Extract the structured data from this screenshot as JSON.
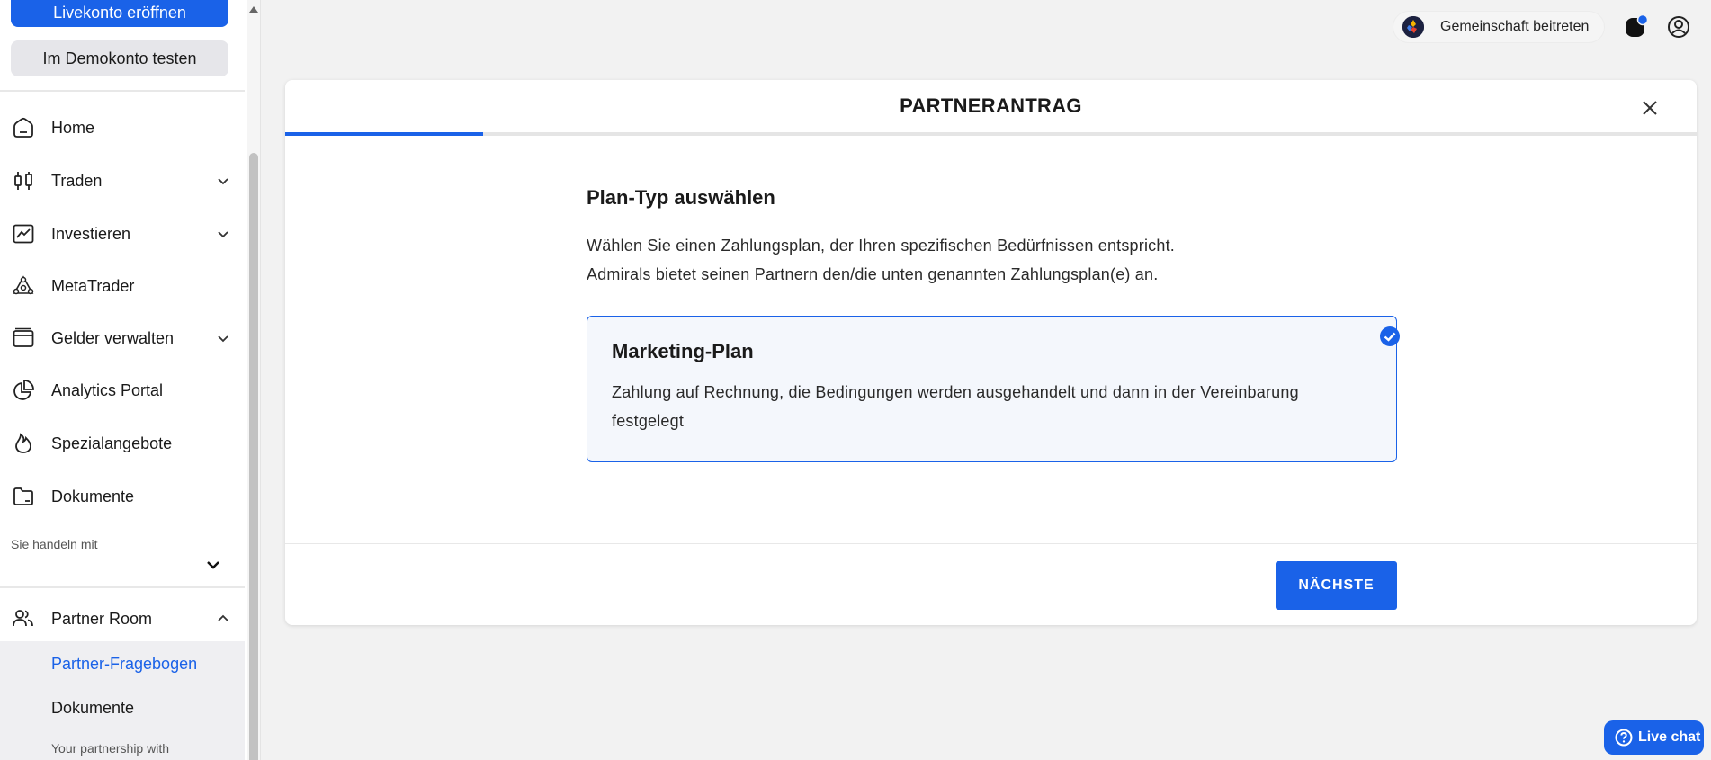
{
  "sidebar": {
    "live_account_button": "Livekonto eröffnen",
    "demo_account_button": "Im Demokonto testen",
    "nav_items": [
      {
        "label": "Home",
        "icon": "home-icon"
      },
      {
        "label": "Traden",
        "icon": "candlestick-icon"
      },
      {
        "label": "Investieren",
        "icon": "chart-line-icon"
      },
      {
        "label": "MetaTrader",
        "icon": "metatrader-icon"
      },
      {
        "label": "Gelder verwalten",
        "icon": "wallet-icon"
      },
      {
        "label": "Analytics Portal",
        "icon": "pie-chart-icon"
      },
      {
        "label": "Spezialangebote",
        "icon": "flame-icon"
      },
      {
        "label": "Dokumente",
        "icon": "folder-icon"
      }
    ],
    "trading_with_label": "Sie handeln mit",
    "partner_room": {
      "label": "Partner Room",
      "icon": "people-icon",
      "sub_items": [
        {
          "label": "Partner-Fragebogen",
          "active": true
        },
        {
          "label": "Dokumente",
          "active": false
        }
      ],
      "partnership_text": "Your partnership with"
    }
  },
  "topbar": {
    "community_label": "Gemeinschaft beitreten",
    "notification_icon": "notification-icon",
    "profile_icon": "profile-icon"
  },
  "modal": {
    "title": "PARTNERANTRAG",
    "progress": 0.14,
    "section_title": "Plan-Typ auswählen",
    "description_line1": "Wählen Sie einen Zahlungsplan, der Ihren spezifischen Bedürfnissen entspricht.",
    "description_line2": "Admirals bietet seinen Partnern den/die unten genannten Zahlungsplan(e) an.",
    "plan": {
      "title": "Marketing-Plan",
      "description": "Zahlung auf Rechnung, die Bedingungen werden ausgehandelt und dann in der Vereinbarung festgelegt",
      "selected": true
    },
    "next_button": "NÄCHSTE"
  },
  "live_chat": {
    "label": "Live chat"
  },
  "colors": {
    "accent": "#1a62e8",
    "background": "#f2f2f2"
  }
}
